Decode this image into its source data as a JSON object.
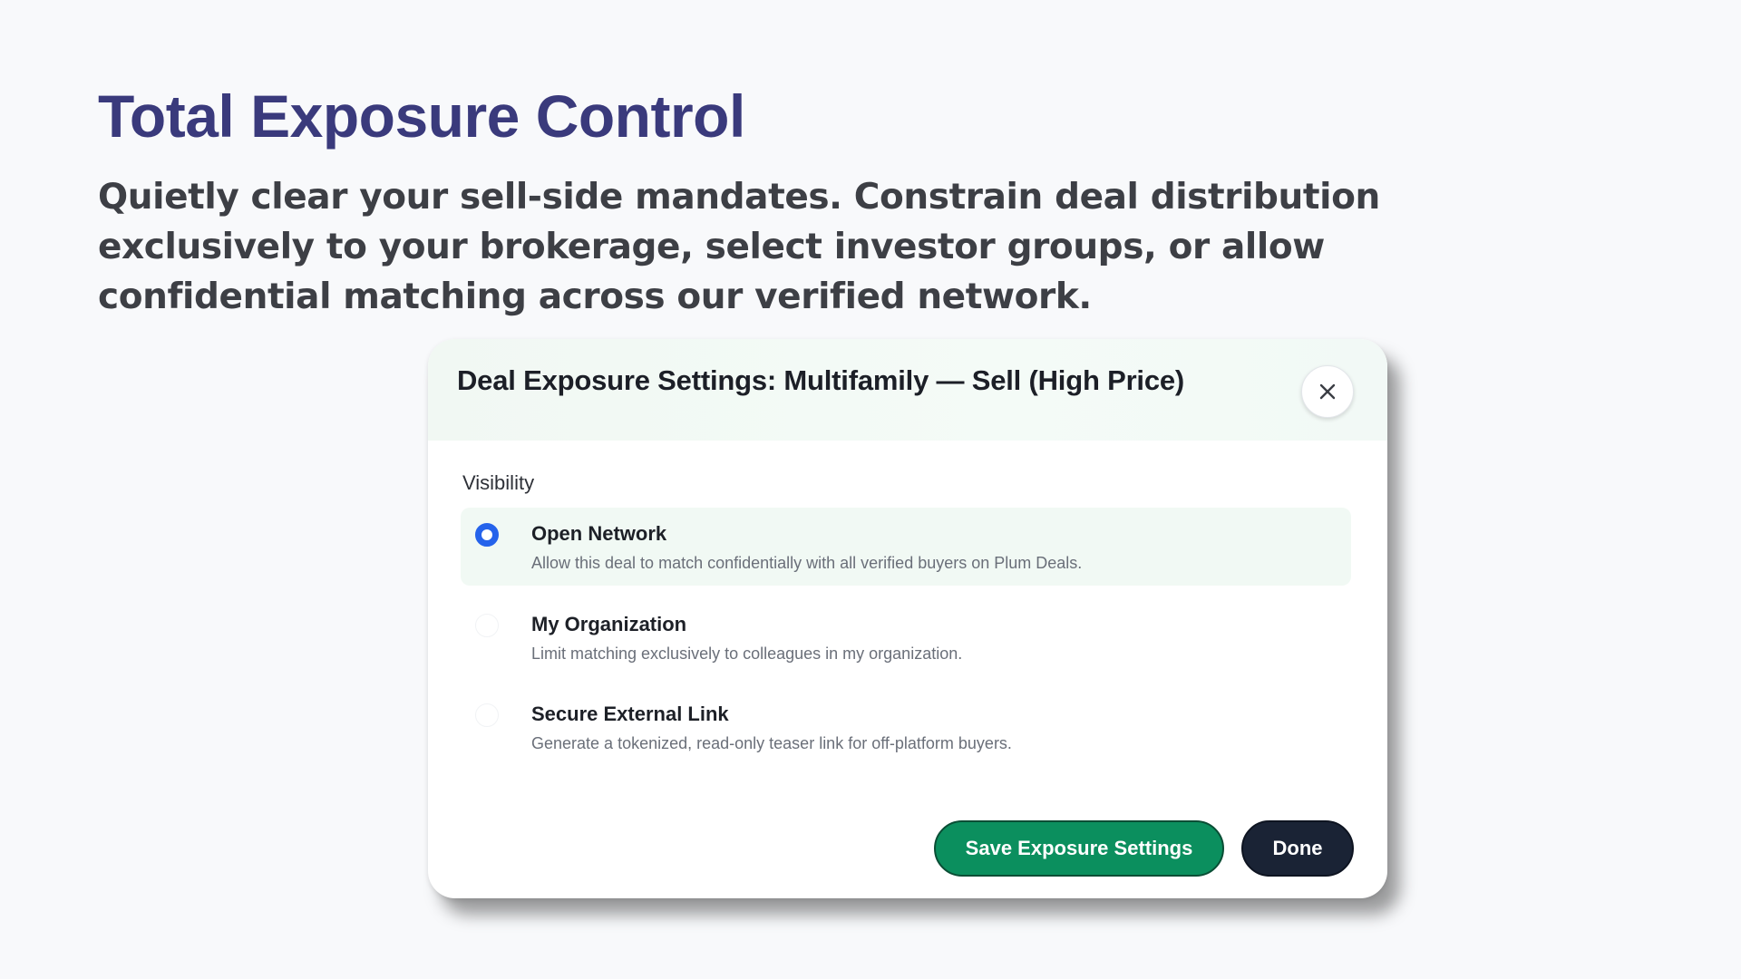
{
  "hero": {
    "title": "Total Exposure Control",
    "subtitle": "Quietly clear your sell-side mandates. Constrain deal distribution exclusively to your brokerage, select investor groups, or allow confidential matching across our verified network."
  },
  "modal": {
    "title": "Deal Exposure Settings: Multifamily — Sell (High Price)",
    "close_icon": "close-icon",
    "section_label": "Visibility",
    "options": [
      {
        "title": "Open Network",
        "description": "Allow this deal to match confidentially with all verified buyers on Plum Deals.",
        "selected": true
      },
      {
        "title": "My Organization",
        "description": "Limit matching exclusively to colleagues in my organization.",
        "selected": false
      },
      {
        "title": "Secure External Link",
        "description": "Generate a tokenized, read-only teaser link for off-platform buyers.",
        "selected": false
      }
    ],
    "save_label": "Save Exposure Settings",
    "done_label": "Done"
  },
  "colors": {
    "heading": "#3a3a7c",
    "radio_selected": "#2563eb",
    "save_button": "#0b8f5e",
    "done_button": "#1a2335",
    "selected_row": "#f1f9f4"
  }
}
